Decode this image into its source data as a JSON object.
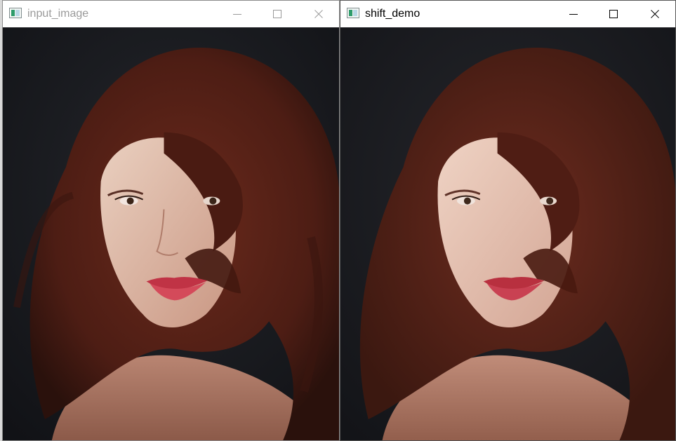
{
  "windows": [
    {
      "title": "input_image",
      "active": false,
      "image": "photo-original-portrait",
      "controls": {
        "minimize": "minimize-icon",
        "maximize": "maximize-icon",
        "close": "close-icon"
      }
    },
    {
      "title": "shift_demo",
      "active": true,
      "image": "photo-mean-shift-filtered-portrait",
      "controls": {
        "minimize": "minimize-icon",
        "maximize": "maximize-icon",
        "close": "close-icon"
      }
    }
  ],
  "colors": {
    "background": "#16171b",
    "hair": "#5a2318",
    "skin": "#e2b9a5",
    "lips": "#c9394a",
    "inactive_title": "#9a9a9a",
    "active_title": "#000000"
  }
}
